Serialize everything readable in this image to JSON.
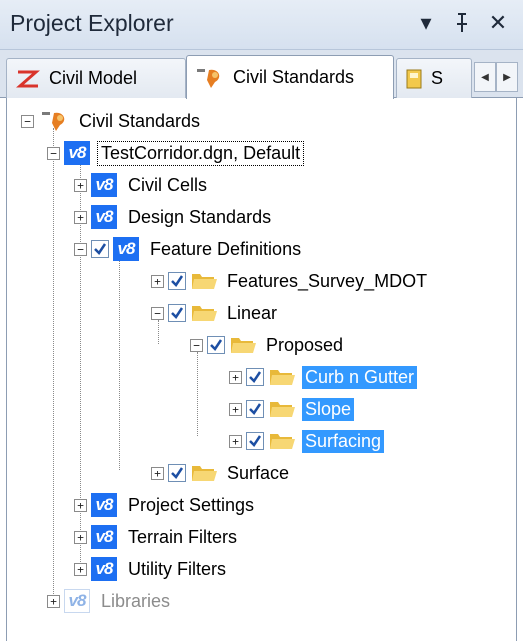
{
  "panel": {
    "title": "Project Explorer",
    "buttons": {
      "dropdown": "▾",
      "pin": "ᵻ",
      "close": "✕"
    }
  },
  "tabs": [
    {
      "label": "Civil Model",
      "icon": "civil-model-icon",
      "active": false
    },
    {
      "label": "Civil Standards",
      "icon": "civil-standards-icon",
      "active": true
    },
    {
      "label": "S",
      "icon": "book-icon",
      "active": false
    }
  ],
  "tree": {
    "root": {
      "label": "Civil Standards",
      "icon": "civil-standards-icon",
      "expander": "−"
    },
    "file": {
      "label": "TestCorridor.dgn, Default",
      "icon": "v8-icon",
      "expander": "−"
    },
    "civil_cells": {
      "label": "Civil Cells",
      "expander": "+"
    },
    "design_standards": {
      "label": "Design Standards",
      "expander": "+"
    },
    "feature_definitions": {
      "label": "Feature Definitions",
      "expander": "−",
      "checked": true
    },
    "features_survey": {
      "label": "Features_Survey_MDOT",
      "expander": "+",
      "checked": true
    },
    "linear": {
      "label": "Linear",
      "expander": "−",
      "checked": true
    },
    "proposed": {
      "label": "Proposed",
      "expander": "−",
      "checked": true
    },
    "curb": {
      "label": "Curb n Gutter",
      "expander": "+",
      "checked": true,
      "selected": true
    },
    "slope": {
      "label": "Slope",
      "expander": "+",
      "checked": true,
      "selected": true
    },
    "surfacing": {
      "label": "Surfacing",
      "expander": "+",
      "checked": true,
      "selected": true
    },
    "surface": {
      "label": "Surface",
      "expander": "+",
      "checked": true
    },
    "project_settings": {
      "label": "Project Settings",
      "expander": "+"
    },
    "terrain_filters": {
      "label": "Terrain Filters",
      "expander": "+"
    },
    "utility_filters": {
      "label": "Utility Filters",
      "expander": "+"
    },
    "libraries": {
      "label": "Libraries",
      "expander": "+",
      "dim": true
    }
  },
  "colors": {
    "selection": "#3399ff",
    "v8_badge": "#1d6ff2",
    "folder": "#f2c94c",
    "check": "#1d4fa3"
  },
  "v8_text": "v8"
}
